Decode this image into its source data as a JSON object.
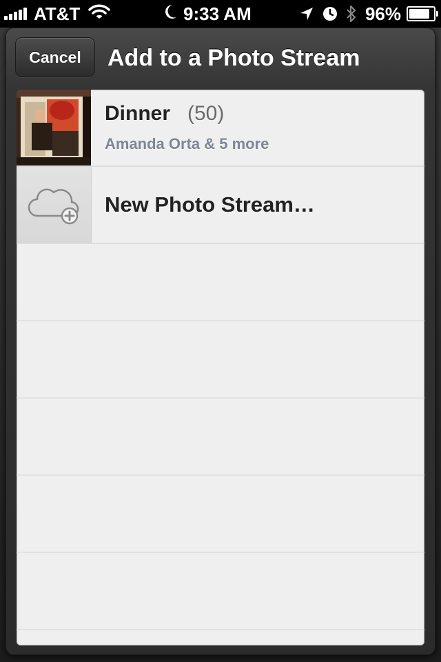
{
  "status_bar": {
    "carrier": "AT&T",
    "time": "9:33 AM",
    "battery_percent": "96%",
    "battery_level": 0.96,
    "icons": [
      "signal-icon",
      "wifi-icon",
      "moon-icon",
      "location-arrow-icon",
      "alarm-clock-icon",
      "bluetooth-icon",
      "battery-icon"
    ]
  },
  "header": {
    "cancel_label": "Cancel",
    "title": "Add to a Photo Stream"
  },
  "streams": [
    {
      "name": "Dinner",
      "count": "(50)",
      "subtitle": "Amanda Orta & 5 more",
      "thumbnail": "photo"
    }
  ],
  "new_stream": {
    "label": "New Photo Stream…",
    "icon": "cloud-add-icon"
  }
}
